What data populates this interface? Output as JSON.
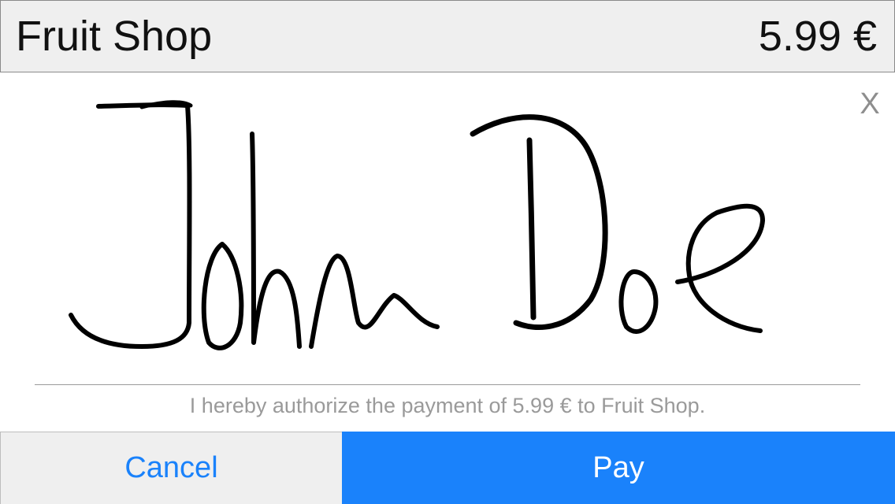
{
  "header": {
    "merchant": "Fruit Shop",
    "amount": "5.99 €"
  },
  "close_label": "X",
  "signature": {
    "text": "John Doe",
    "ink_color": "#000000"
  },
  "authorization_text": "I hereby authorize the payment of 5.99 € to Fruit Shop.",
  "buttons": {
    "cancel_label": "Cancel",
    "pay_label": "Pay"
  },
  "colors": {
    "accent": "#1a82fb",
    "header_bg": "#efefef",
    "muted_text": "#9a9a9a"
  }
}
